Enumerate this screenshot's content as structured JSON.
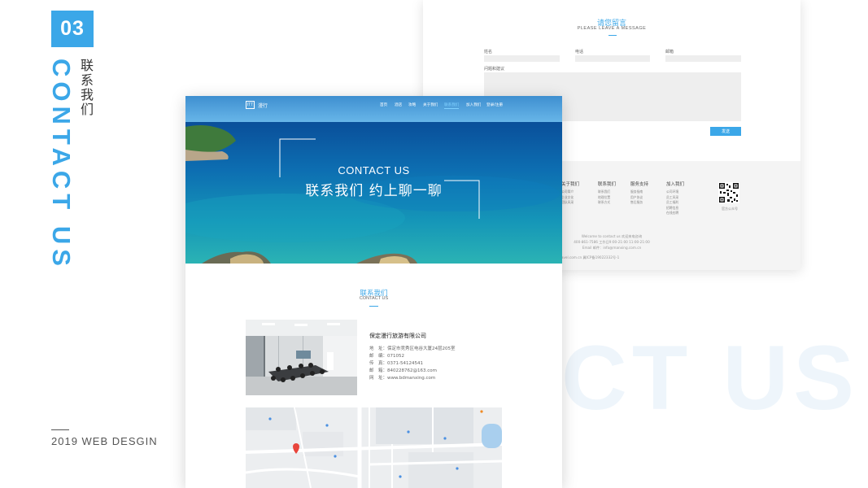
{
  "deco": {
    "number": "03",
    "vertical_en": "CONTACT US",
    "vertical_cn": [
      "联",
      "系",
      "我",
      "们"
    ],
    "footer_text": "2019 WEB DESGIN",
    "watermark": "CT US",
    "accent": "#3ba7e8"
  },
  "message_page": {
    "title": "请您留言",
    "subtitle": "PLEASE LEAVE A MESSAGE",
    "fields": {
      "name": "姓名",
      "phone": "电话",
      "email": "邮箱",
      "question": "问题和建议"
    },
    "submit": "发送",
    "footer_columns": [
      {
        "heading": "关于我们",
        "items": [
          "公司简介",
          "企业文化",
          "团队风采"
        ]
      },
      {
        "heading": "联系我们",
        "items": [
          "联系我们",
          "地理位置",
          "联系方式"
        ]
      },
      {
        "heading": "服务支持",
        "items": [
          "服务指南",
          "用户协议",
          "售后服务"
        ]
      },
      {
        "heading": "加入我们",
        "items": [
          "公司环境",
          "员工风采",
          "员工福利",
          "招聘信息",
          "在线应聘"
        ]
      }
    ],
    "qr_label": "官方公众号",
    "footer_lines": [
      "Welcome to contact us 欢迎来电咨询",
      "400-861-7586 工作日9:00-21:00 11:00-21:00",
      "Email 邮件：info@manxing.com.cn",
      "© manxingtravel.com.cn 冀ICP备19022332号-1"
    ]
  },
  "front_page": {
    "logo_mark": "ITT",
    "logo_text": "漫行",
    "nav": [
      "首页",
      "酒店",
      "攻略",
      "关于我们",
      "联系我们",
      "加入我们",
      "登录/注册"
    ],
    "nav_active_index": 4,
    "hero_en": "CONTACT US",
    "hero_cn": "联系我们  约上聊一聊",
    "section_title": "联系我们",
    "section_sub": "CONTACT US",
    "company": "保定漫行旅游有限公司",
    "info": [
      {
        "label": "地　址：",
        "value": "保定市竞秀区电谷大厦24层205室"
      },
      {
        "label": "邮　编：",
        "value": "071052"
      },
      {
        "label": "传　真：",
        "value": "0371-54124541"
      },
      {
        "label": "邮　箱：",
        "value": "840228762@163.com"
      },
      {
        "label": "网　址：",
        "value": "www.bdmanxing.com"
      }
    ]
  }
}
